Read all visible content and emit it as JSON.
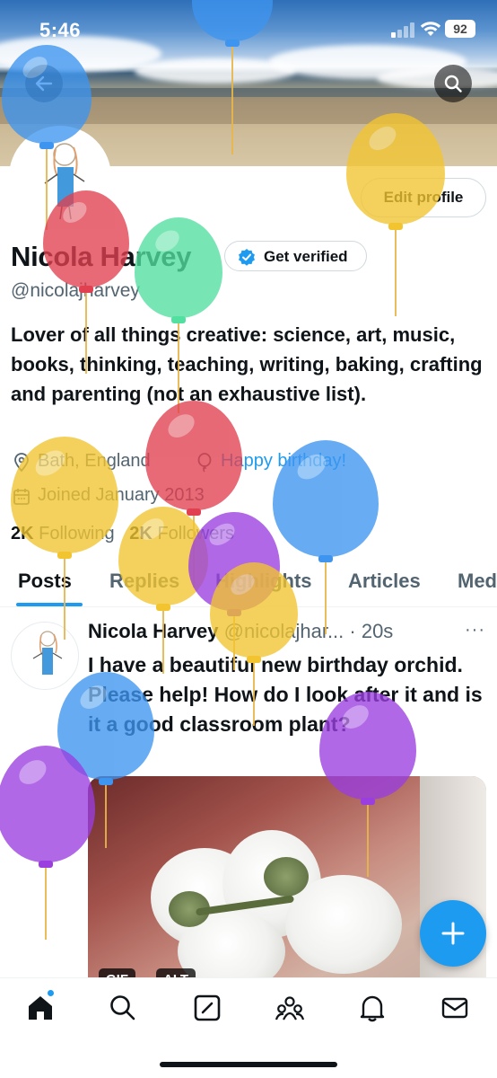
{
  "status_bar": {
    "time": "5:46",
    "battery": "92"
  },
  "profile": {
    "name": "Nicola Harvey",
    "handle": "@nicolajharvey",
    "get_verified_label": "Get verified",
    "edit_profile_label": "Edit profile",
    "bio": "Lover of all things creative: science, art, music, books, thinking, teaching, writing, baking, crafting and parenting (not an exhaustive list).",
    "location": "Bath, England",
    "website": "Happy birthday!",
    "joined": "Joined January 2013",
    "following_count": "2K",
    "following_label": "Following",
    "followers_count": "2K",
    "followers_label": "Followers"
  },
  "tabs": [
    {
      "label": "Posts"
    },
    {
      "label": "Replies"
    },
    {
      "label": "Highlights"
    },
    {
      "label": "Articles"
    },
    {
      "label": "Media"
    }
  ],
  "tweet": {
    "name": "Nicola Harvey",
    "handle_time": "@nicolajhar... · 20s",
    "more": "···",
    "text": "I have a beautiful new birthday orchid.  Please help! How do I look after it and is it a good classroom plant?",
    "badges": [
      "GIF",
      "ALT"
    ]
  },
  "icons": {
    "back": "back-arrow-icon",
    "search": "search-icon",
    "verified": "verified-badge-icon",
    "location": "location-pin-icon",
    "website": "balloon-icon",
    "calendar": "calendar-icon",
    "compose": "plus-icon",
    "nav": [
      "home-icon",
      "search-icon",
      "grok-icon",
      "communities-icon",
      "bell-icon",
      "mail-icon"
    ]
  },
  "colors": {
    "accent": "#1d9bf0",
    "text": "#0f1419",
    "secondary": "#536471"
  }
}
